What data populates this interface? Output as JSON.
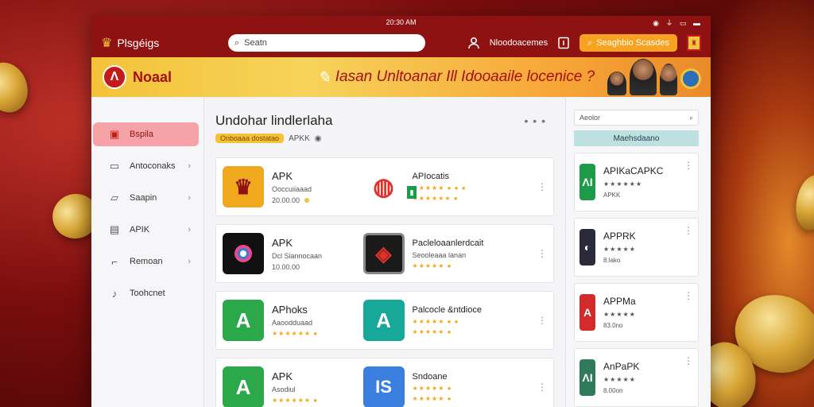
{
  "statusbar": {
    "time": "20:30 AM",
    "icons": "◉ ⏚ ▭ ▬"
  },
  "topbar": {
    "logo_text": "Plsgéigs",
    "search_placeholder": "Seatn",
    "user_label": "Nloodoacemes",
    "action_button": "Seaghbio Scasdes"
  },
  "banner": {
    "brand_mark": "Ʌ",
    "brand": "Noaal",
    "slogan": "Iasan Unltoanar Ill Idooaaile locenice ?"
  },
  "sidebar": {
    "items": [
      {
        "label": "Bspila",
        "icon": "flag-icon",
        "active": true
      },
      {
        "label": "Antoconaks",
        "icon": "monitor-icon",
        "chevron": true
      },
      {
        "label": "Saapin",
        "icon": "tablet-icon",
        "chevron": true
      },
      {
        "label": "APIK",
        "icon": "card-icon",
        "chevron": true
      },
      {
        "label": "Remoan",
        "icon": "key-icon",
        "chevron": true
      },
      {
        "label": "Toohcnet",
        "icon": "bell-icon"
      }
    ]
  },
  "main": {
    "title": "Undohar lindlerlaha",
    "badge": "Onboaaa dostatao",
    "sub_label": "APKK",
    "more": "• • •",
    "rows": [
      {
        "left": {
          "name": "APK",
          "meta1": "Ooccuiiaaad",
          "meta2": "20.00.00"
        },
        "right": {
          "name": "APIocatis",
          "meta1": "★★★★★ ● ● ●",
          "meta2": "★★★★★★ ●"
        }
      },
      {
        "left": {
          "name": "APK",
          "meta1": "Dcl Siannocaan",
          "meta2": "10.00.00"
        },
        "right": {
          "name": "Pacleloaanlerdcait",
          "meta1": "Seooleaaa lanan",
          "meta2": "★★★★★ ●"
        }
      },
      {
        "left": {
          "name": "APhoks",
          "meta1": "Aaoodduaad",
          "meta2": "★★★★★★ ●"
        },
        "right": {
          "name": "Palcocle &ntdioce",
          "meta1": "★★★★★ ● ●",
          "meta2": "★★★★★ ●"
        }
      },
      {
        "left": {
          "name": "APK",
          "meta1": "Asodiul",
          "meta2": "★★★★★★ ●"
        },
        "right": {
          "name": "Sndoane",
          "meta1": "★★★★★ ●",
          "meta2": "★★★★★ ●"
        }
      }
    ]
  },
  "rightcol": {
    "search_placeholder": "Aeolor",
    "button": "Maehsdaano",
    "items": [
      {
        "name": "APIKaCAPKC",
        "meta1": "★★★★★★",
        "meta2": "APKK",
        "icon_text": "ɅI",
        "color": "#1d9a4a"
      },
      {
        "name": "APPRK",
        "meta1": "★★★★★",
        "meta2": "8.lako",
        "icon_text": "◐",
        "color": "#2a2a3a"
      },
      {
        "name": "APPMa",
        "meta1": "★★★★★",
        "meta2": "83.0no",
        "icon_text": "A",
        "color": "#d42a2a"
      },
      {
        "name": "AnPaPK",
        "meta1": "★★★★★",
        "meta2": "8.00on",
        "icon_text": "ɅI",
        "color": "#2e7a5a"
      }
    ]
  },
  "colors": {
    "brand_red": "#8e1212",
    "accent_gold": "#f4c238",
    "accent_orange": "#f6a321"
  }
}
